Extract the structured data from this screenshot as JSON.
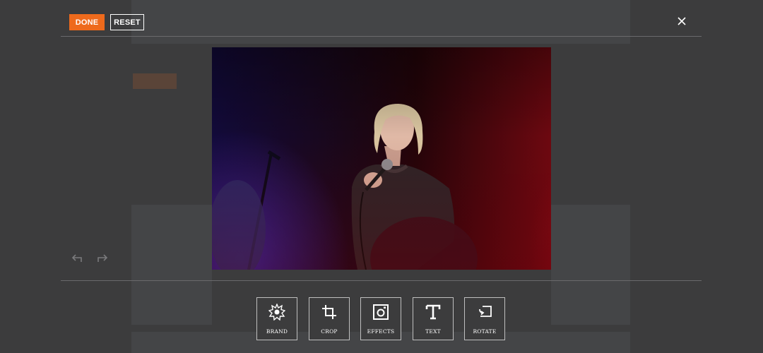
{
  "toolbar": {
    "done_label": "DONE",
    "reset_label": "RESET",
    "close_icon": "close-icon"
  },
  "history": {
    "undo_icon": "undo-icon",
    "redo_icon": "redo-icon"
  },
  "tools": [
    {
      "label": "BRAND",
      "icon": "brand-badge-icon"
    },
    {
      "label": "CROP",
      "icon": "crop-icon"
    },
    {
      "label": "EFFECTS",
      "icon": "effects-camera-icon"
    },
    {
      "label": "TEXT",
      "icon": "text-icon"
    },
    {
      "label": "ROTATE",
      "icon": "rotate-icon"
    }
  ],
  "colors": {
    "overlay": "#3c3c3d",
    "accent": "#ee6a1c",
    "rule": "#6a6a6c"
  }
}
